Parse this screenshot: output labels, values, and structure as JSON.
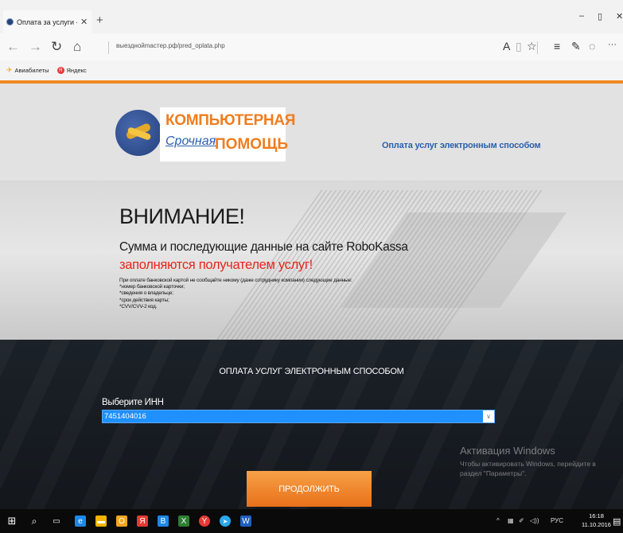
{
  "browser": {
    "tab_title": "Оплата за услуги - Вые",
    "tab_close": "✕",
    "new_tab": "+",
    "url": "выезднойmaстер.рф/pred_oplata.php",
    "window_controls": {
      "minimize": "–",
      "maximize": "▯",
      "close": "✕"
    },
    "nav_icons": {
      "back": "←",
      "forward": "→",
      "refresh": "↻",
      "home": "⌂"
    },
    "toolbar_icons": {
      "reader": "A",
      "reading_list": "▯",
      "favorite": "☆",
      "hub": "≡",
      "note": "✎",
      "share": "◌",
      "more": "···"
    }
  },
  "favorites": [
    {
      "label": "Авиабилеты",
      "icon": "plane-icon"
    },
    {
      "label": "Яндекс",
      "icon": "yandex-icon",
      "glyph": "Я"
    }
  ],
  "site": {
    "logo": {
      "line1": "КОМПЬЮТЕРНАЯ",
      "line2": "Срочная",
      "line3": "ПОМОЩЬ"
    },
    "tagline": "Оплата услуг электронным способом",
    "banner": {
      "title": "ВНИМАНИЕ!",
      "line1": "Сумма и последующие данные на сайте RoboKassa",
      "line2": "заполняются получателем услуг!",
      "notes": [
        "При оплате банковской картой не сообщайте никому (даже сотруднику компании) следующие данные:",
        "*номер банковской карточки;",
        "*сведения о владельце;",
        "*срок действия карты;",
        "*CVV/CVV-2 код."
      ]
    },
    "form": {
      "title": "ОПЛАТА УСЛУГ ЭЛЕКТРОННЫМ СПОСОБОМ",
      "inn_label": "Выберите ИНН",
      "inn_value": "7451404016",
      "submit": "ПРОДОЛЖИТЬ"
    }
  },
  "windows_activation": {
    "title": "Активация Windows",
    "text": "Чтобы активировать Windows, перейдите в раздел \"Параметры\"."
  },
  "taskbar": {
    "language": "РУС",
    "time": "16:18",
    "date": "11.10.2016",
    "start": "⊞",
    "search": "⌕",
    "task_view": "▭",
    "apps": [
      {
        "name": "edge",
        "glyph": "e",
        "color": "#1e88e5"
      },
      {
        "name": "explorer",
        "glyph": "▬",
        "color": "#f4b400"
      },
      {
        "name": "outlook",
        "glyph": "O",
        "color": "#f5a623"
      },
      {
        "name": "yandex",
        "glyph": "Я",
        "color": "#e53935"
      },
      {
        "name": "vk",
        "glyph": "В",
        "color": "#1e88e5"
      },
      {
        "name": "excel",
        "glyph": "X",
        "color": "#2e7d32"
      },
      {
        "name": "yandex-browser",
        "glyph": "Y",
        "color": "#e53935"
      },
      {
        "name": "telegram",
        "glyph": "➤",
        "color": "#29a9eb"
      },
      {
        "name": "word",
        "glyph": "W",
        "color": "#1e5fbf"
      }
    ],
    "tray_icons": {
      "chevron": "^",
      "network": "▦",
      "pen": "✐",
      "volume": "◁))"
    }
  }
}
